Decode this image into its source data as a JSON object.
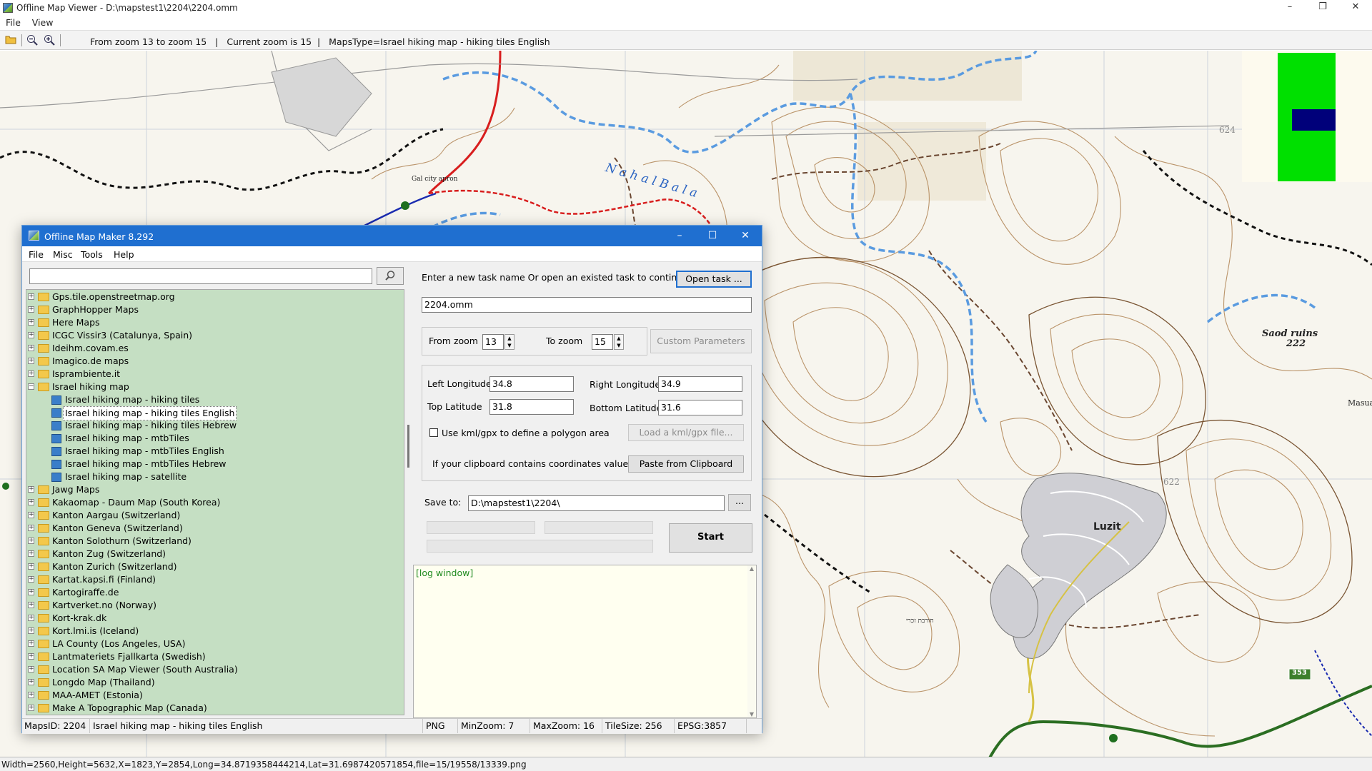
{
  "viewer": {
    "title": "Offline Map Viewer - D:\\mapstest1\\2204\\2204.omm",
    "menu": [
      "File",
      "View"
    ],
    "window_controls": {
      "minimize": "–",
      "maximize": "❐",
      "close": "✕"
    },
    "toolbar_info": "From zoom 13 to zoom 15   |   Current zoom is 15  |   MapsType=Israel hiking map - hiking tiles English",
    "status": "Width=2560,Height=5632,X=1823,Y=2854,Long=34.8719358444214,Lat=31.6987420571854,file=15/19558/13339.png",
    "icons": [
      "open-folder-icon",
      "zoom-out-icon",
      "zoom-in-icon"
    ]
  },
  "map": {
    "labels": {
      "apron": "Gal city apron",
      "river": "N a h a l   B a l a",
      "sood_ruins": "Saod ruins",
      "sood_elev": "222",
      "luzit": "Luzit",
      "masua": "Masua",
      "elev_624": "624",
      "elev_622": "622",
      "road_353": "353",
      "hurvat": "חורבת זכרי"
    }
  },
  "dialog": {
    "title": "Offline Map Maker 8.292",
    "window_controls": {
      "minimize": "–",
      "maximize": "☐",
      "close": "✕"
    },
    "menu": [
      "File",
      "Misc",
      "Tools",
      "Help"
    ],
    "search": {
      "value": "",
      "button": "⌕"
    },
    "tree": [
      {
        "label": "Gps.tile.openstreetmap.org",
        "level": 0,
        "expanded": false
      },
      {
        "label": "GraphHopper Maps",
        "level": 0,
        "expanded": false
      },
      {
        "label": "Here Maps",
        "level": 0,
        "expanded": false
      },
      {
        "label": "ICGC Vissir3 (Catalunya, Spain)",
        "level": 0,
        "expanded": false
      },
      {
        "label": "Ideihm.covam.es",
        "level": 0,
        "expanded": false
      },
      {
        "label": "Imagico.de maps",
        "level": 0,
        "expanded": false
      },
      {
        "label": "Isprambiente.it",
        "level": 0,
        "expanded": false
      },
      {
        "label": "Israel hiking map",
        "level": 0,
        "expanded": true
      },
      {
        "label": "Israel hiking map - hiking tiles",
        "level": 1
      },
      {
        "label": "Israel hiking map - hiking tiles English",
        "level": 1,
        "selected": true
      },
      {
        "label": "Israel hiking map - hiking tiles Hebrew",
        "level": 1
      },
      {
        "label": "Israel hiking map - mtbTiles",
        "level": 1
      },
      {
        "label": "Israel hiking map - mtbTiles English",
        "level": 1
      },
      {
        "label": "Israel hiking map - mtbTiles Hebrew",
        "level": 1
      },
      {
        "label": "Israel hiking map - satellite",
        "level": 1
      },
      {
        "label": "Jawg Maps",
        "level": 0,
        "expanded": false
      },
      {
        "label": "Kakaomap - Daum Map (South Korea)",
        "level": 0,
        "expanded": false
      },
      {
        "label": "Kanton Aargau (Switzerland)",
        "level": 0,
        "expanded": false
      },
      {
        "label": "Kanton Geneva (Switzerland)",
        "level": 0,
        "expanded": false
      },
      {
        "label": "Kanton Solothurn (Switzerland)",
        "level": 0,
        "expanded": false
      },
      {
        "label": "Kanton Zug (Switzerland)",
        "level": 0,
        "expanded": false
      },
      {
        "label": "Kanton Zurich (Switzerland)",
        "level": 0,
        "expanded": false
      },
      {
        "label": "Kartat.kapsi.fi (Finland)",
        "level": 0,
        "expanded": false
      },
      {
        "label": "Kartogiraffe.de",
        "level": 0,
        "expanded": false
      },
      {
        "label": "Kartverket.no (Norway)",
        "level": 0,
        "expanded": false
      },
      {
        "label": "Kort-krak.dk",
        "level": 0,
        "expanded": false
      },
      {
        "label": "Kort.lmi.is (Iceland)",
        "level": 0,
        "expanded": false
      },
      {
        "label": "LA County (Los Angeles, USA)",
        "level": 0,
        "expanded": false
      },
      {
        "label": "Lantmateriets Fjallkarta (Swedish)",
        "level": 0,
        "expanded": false
      },
      {
        "label": "Location SA Map Viewer (South Australia)",
        "level": 0,
        "expanded": false
      },
      {
        "label": "Longdo Map (Thailand)",
        "level": 0,
        "expanded": false
      },
      {
        "label": "MAA-AMET (Estonia)",
        "level": 0,
        "expanded": false
      },
      {
        "label": "Make A Topographic Map (Canada)",
        "level": 0,
        "expanded": false
      }
    ],
    "task_prompt": "Enter a new task name Or open an existed task to continue:",
    "open_task_button": "Open task ...",
    "task_name": "2204.omm",
    "from_zoom_label": "From zoom",
    "from_zoom": "13",
    "to_zoom_label": "To zoom",
    "to_zoom": "15",
    "custom_params_button": "Custom Parameters",
    "left_longitude_label": "Left Longitude",
    "left_longitude": "34.8",
    "right_longitude_label": "Right Longitude",
    "right_longitude": "34.9",
    "top_latitude_label": "Top Latitude",
    "top_latitude": "31.8",
    "bottom_latitude_label": "Bottom Latitude",
    "bottom_latitude": "31.6",
    "kml_checkbox_label": "Use kml/gpx to define a polygon area",
    "kml_checked": false,
    "load_kml_button": "Load a kml/gpx file...",
    "clipboard_prompt": "If your clipboard contains coordinates values:",
    "paste_button": "Paste from Clipboard",
    "save_to_label": "Save to:",
    "save_to": "D:\\mapstest1\\2204\\",
    "browse_button": "...",
    "start_button": "Start",
    "progress": [
      0,
      0,
      0
    ],
    "log_text": "[log window]",
    "status": {
      "maps_id": "MapsID: 2204",
      "map_name": "Israel hiking map - hiking tiles English",
      "format": "PNG",
      "min_zoom": "MinZoom: 7",
      "max_zoom": "MaxZoom: 16",
      "tile_size": "TileSize: 256",
      "epsg": "EPSG:3857"
    }
  }
}
